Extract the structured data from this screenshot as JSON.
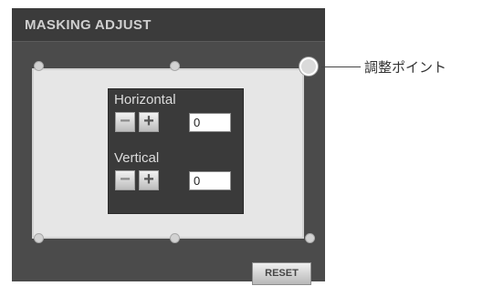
{
  "panel": {
    "title": "MASKING ADJUST"
  },
  "callout": {
    "label": "調整ポイント"
  },
  "horizontal": {
    "label": "Horizontal",
    "minus": "−",
    "plus": "+",
    "value": "0"
  },
  "vertical": {
    "label": "Vertical",
    "minus": "−",
    "plus": "+",
    "value": "0"
  },
  "reset_label": "RESET",
  "icons": {
    "handle": "adjustment-point-handle",
    "handle_highlighted": "adjustment-point-highlighted"
  }
}
